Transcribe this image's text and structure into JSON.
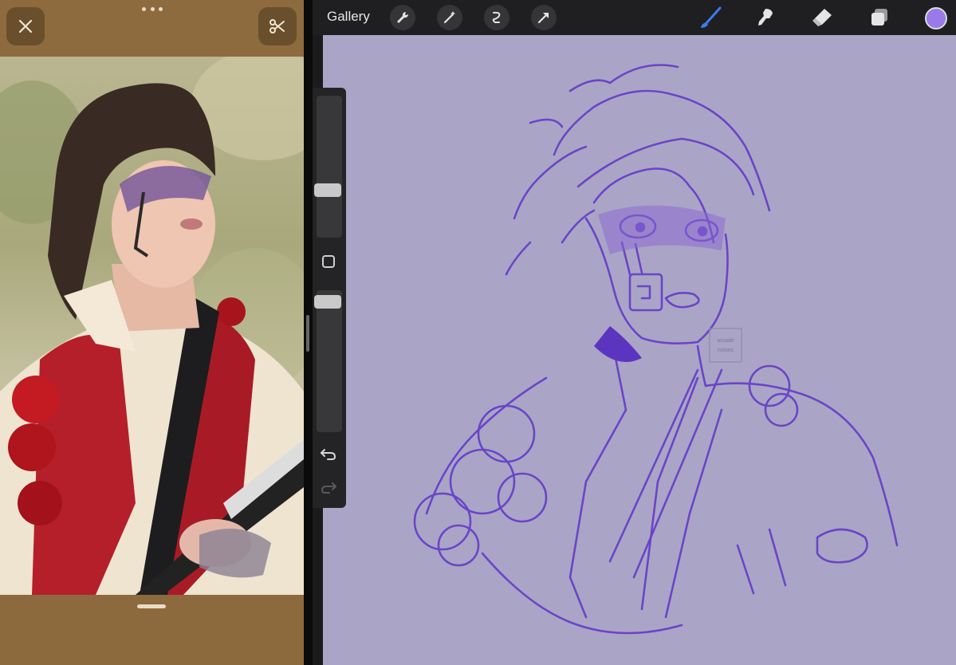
{
  "reference_panel": {
    "close_icon": "close-icon",
    "cut_icon": "scissors-icon",
    "window_menu_icon": "more-dots-icon",
    "photo_subject": "photo"
  },
  "topbar": {
    "gallery_label": "Gallery",
    "tools_left": [
      "wrench-icon",
      "magic-wand-icon",
      "selection-icon",
      "transform-arrow-icon"
    ],
    "tools_right": [
      "brush-icon",
      "smudge-icon",
      "eraser-icon",
      "layers-icon"
    ],
    "current_color": "#9a79e8",
    "active_tool_color": "#3d7bf0"
  },
  "canvas": {
    "background_color": "#aaa5c6",
    "stroke_color": "#6a45c8",
    "watermark_text": "arcade noises"
  },
  "sidebar": {
    "size_icon": "brush-size-slider",
    "opacity_icon": "opacity-slider",
    "modify_icon": "modify-square-icon",
    "undo_icon": "undo-icon",
    "redo_icon": "redo-icon"
  }
}
